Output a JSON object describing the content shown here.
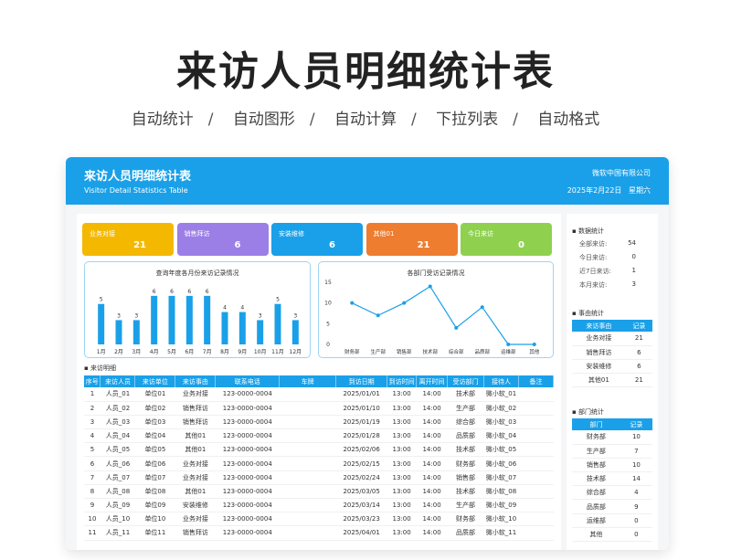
{
  "hero": {
    "title": "来访人员明细统计表",
    "features": [
      "自动统计",
      "自动图形",
      "自动计算",
      "下拉列表",
      "自动格式"
    ]
  },
  "sheet": {
    "title": "来访人员明细统计表",
    "subtitle": "Visitor Detail Statistics Table",
    "company": "微软中国有限公司",
    "date": "2025年2月22日",
    "weekday": "星期六",
    "header_color": "#1aa0e8"
  },
  "cards": [
    {
      "label": "业务对接",
      "value": "21",
      "color": "#f5b800"
    },
    {
      "label": "销售拜访",
      "value": "6",
      "color": "#9b7fe6"
    },
    {
      "label": "安装维修",
      "value": "6",
      "color": "#1aa0e8"
    },
    {
      "label": "其他01",
      "value": "21",
      "color": "#ee7d30"
    },
    {
      "label": "今日来访",
      "value": "0",
      "color": "#8fd14f"
    }
  ],
  "chart_data": [
    {
      "type": "bar",
      "title": "查询年度各月份来访记录情况",
      "categories": [
        "1月",
        "2月",
        "3月",
        "4月",
        "5月",
        "6月",
        "7月",
        "8月",
        "9月",
        "10月",
        "11月",
        "12月"
      ],
      "values": [
        5,
        3,
        3,
        6,
        6,
        6,
        6,
        4,
        4,
        3,
        5,
        3
      ],
      "ylim": [
        0,
        7
      ],
      "color": "#1aa0e8",
      "grid": false,
      "legend": "none"
    },
    {
      "type": "line",
      "title": "各部门受访记录情况",
      "categories": [
        "财务部",
        "生产部",
        "销售部",
        "技术部",
        "综合部",
        "品质部",
        "运维部",
        "其他"
      ],
      "values": [
        10,
        7,
        10,
        14,
        4,
        9,
        0,
        0
      ],
      "ylim": [
        0,
        15
      ],
      "yticks": [
        "0",
        "5",
        "10",
        "15"
      ],
      "color": "#1aa0e8",
      "grid": false,
      "legend": "none"
    }
  ],
  "table": {
    "section_label": "来访明细",
    "headers": [
      "序号",
      "来访人员",
      "来访单位",
      "来访事由",
      "联系电话",
      "车牌",
      "到访日期",
      "到访时间",
      "离开时间",
      "受访部门",
      "接待人",
      "备注"
    ],
    "rows": [
      [
        "1",
        "人员_01",
        "单位01",
        "业务对接",
        "123-0000-0004",
        "",
        "2025/01/01",
        "13:00",
        "14:00",
        "技术部",
        "微小软_01",
        ""
      ],
      [
        "2",
        "人员_02",
        "单位02",
        "销售拜访",
        "123-0000-0004",
        "",
        "2025/01/10",
        "13:00",
        "14:00",
        "生产部",
        "微小软_02",
        ""
      ],
      [
        "3",
        "人员_03",
        "单位03",
        "销售拜访",
        "123-0000-0004",
        "",
        "2025/01/19",
        "13:00",
        "14:00",
        "综合部",
        "微小软_03",
        ""
      ],
      [
        "4",
        "人员_04",
        "单位04",
        "其他01",
        "123-0000-0004",
        "",
        "2025/01/28",
        "13:00",
        "14:00",
        "品质部",
        "微小软_04",
        ""
      ],
      [
        "5",
        "人员_05",
        "单位05",
        "其他01",
        "123-0000-0004",
        "",
        "2025/02/06",
        "13:00",
        "14:00",
        "技术部",
        "微小软_05",
        ""
      ],
      [
        "6",
        "人员_06",
        "单位06",
        "业务对接",
        "123-0000-0004",
        "",
        "2025/02/15",
        "13:00",
        "14:00",
        "财务部",
        "微小软_06",
        ""
      ],
      [
        "7",
        "人员_07",
        "单位07",
        "业务对接",
        "123-0000-0004",
        "",
        "2025/02/24",
        "13:00",
        "14:00",
        "销售部",
        "微小软_07",
        ""
      ],
      [
        "8",
        "人员_08",
        "单位08",
        "其他01",
        "123-0000-0004",
        "",
        "2025/03/05",
        "13:00",
        "14:00",
        "技术部",
        "微小软_08",
        ""
      ],
      [
        "9",
        "人员_09",
        "单位09",
        "安装维修",
        "123-0000-0004",
        "",
        "2025/03/14",
        "13:00",
        "14:00",
        "生产部",
        "微小软_09",
        ""
      ],
      [
        "10",
        "人员_10",
        "单位10",
        "业务对接",
        "123-0000-0004",
        "",
        "2025/03/23",
        "13:00",
        "14:00",
        "财务部",
        "微小软_10",
        ""
      ],
      [
        "11",
        "人员_11",
        "单位11",
        "销售拜访",
        "123-0000-0004",
        "",
        "2025/04/01",
        "13:00",
        "14:00",
        "品质部",
        "微小软_11",
        ""
      ]
    ]
  },
  "side": {
    "data_stats_title": "数据统计",
    "data_stats": [
      {
        "label": "全部来访:",
        "value": "54"
      },
      {
        "label": "今日来访:",
        "value": "0"
      },
      {
        "label": "近7日来访:",
        "value": "1"
      },
      {
        "label": "本月来访:",
        "value": "3"
      }
    ],
    "reason_title": "事由统计",
    "reason_headers": [
      "来访事由",
      "记录"
    ],
    "reason_rows": [
      [
        "业务对接",
        "21"
      ],
      [
        "销售拜访",
        "6"
      ],
      [
        "安装维修",
        "6"
      ],
      [
        "其他01",
        "21"
      ]
    ],
    "dept_title": "部门统计",
    "dept_headers": [
      "部门",
      "记录"
    ],
    "dept_rows": [
      [
        "财务部",
        "10"
      ],
      [
        "生产部",
        "7"
      ],
      [
        "销售部",
        "10"
      ],
      [
        "技术部",
        "14"
      ],
      [
        "综合部",
        "4"
      ],
      [
        "品质部",
        "9"
      ],
      [
        "运维部",
        "0"
      ],
      [
        "其他",
        "0"
      ]
    ]
  }
}
